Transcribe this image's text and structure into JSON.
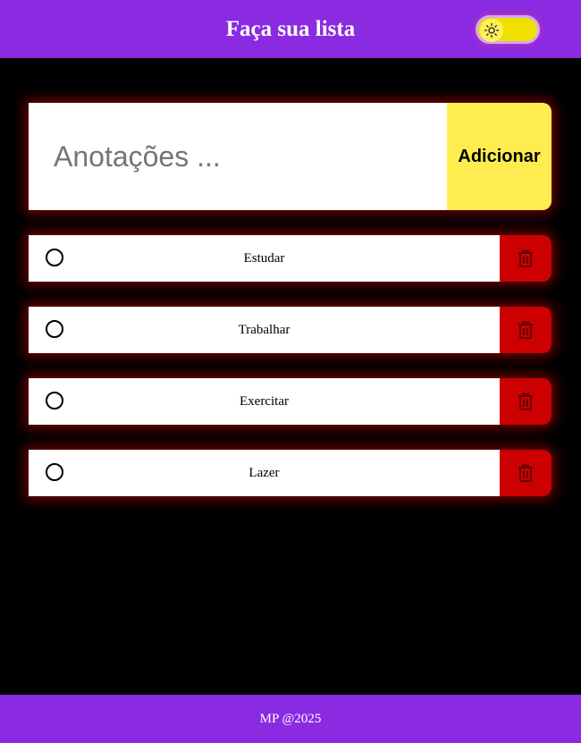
{
  "header": {
    "title": "Faça sua lista",
    "theme_toggle_icon": "sun-icon"
  },
  "form": {
    "placeholder": "Anotações ...",
    "add_label": "Adicionar"
  },
  "tasks": [
    {
      "label": "Estudar",
      "done": false
    },
    {
      "label": "Trabalhar",
      "done": false
    },
    {
      "label": "Exercitar",
      "done": false
    },
    {
      "label": "Lazer",
      "done": false
    }
  ],
  "task_icons": {
    "check": "circle-checkbox-icon",
    "delete": "trash-icon"
  },
  "footer": {
    "text": "MP @2025"
  },
  "colors": {
    "brand": "#8a2be2",
    "add_button": "#ffed4f",
    "delete_button": "#cc0000",
    "background": "#000000",
    "glow": "#960000"
  }
}
